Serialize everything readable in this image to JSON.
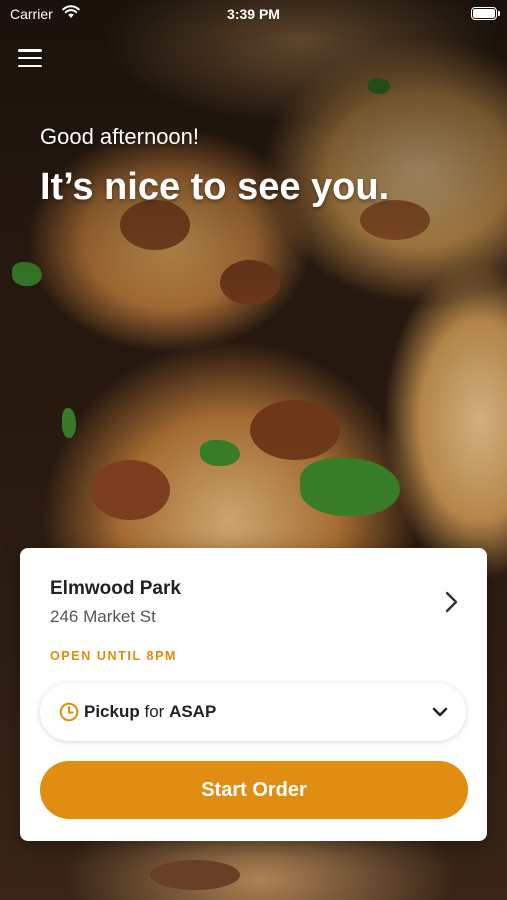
{
  "status_bar": {
    "carrier": "Carrier",
    "time": "3:39 PM"
  },
  "hero": {
    "greeting": "Good afternoon!",
    "headline": "It’s nice to see you."
  },
  "location": {
    "name": "Elmwood Park",
    "address": "246 Market St",
    "hours": "OPEN UNTIL 8PM"
  },
  "pickup": {
    "mode": "Pickup",
    "connector": "for",
    "time": "ASAP"
  },
  "start_order_label": "Start Order",
  "colors": {
    "accent": "#e08d12",
    "hours_text": "#e38a0a"
  },
  "icons": {
    "menu": "hamburger-menu-icon",
    "chevron": "chevron-right-icon",
    "clock": "clock-icon",
    "dropdown": "chevron-down-icon"
  }
}
